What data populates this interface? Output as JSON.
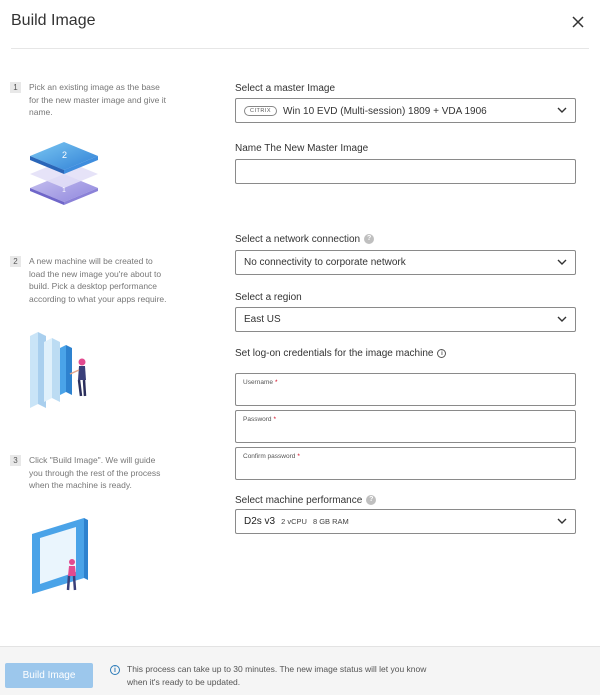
{
  "dialog": {
    "title": "Build Image",
    "close_icon": "close-icon"
  },
  "steps": [
    {
      "number": "1",
      "text": "Pick an existing image as the base for the new master image and give it name."
    },
    {
      "number": "2",
      "text": "A new machine will be created to load the new image you're about to build. Pick a desktop performance according to what your apps require."
    },
    {
      "number": "3",
      "text": "Click \"Build Image\". We will guide you through the rest of the process when the machine is ready."
    }
  ],
  "form": {
    "master_image": {
      "label": "Select a master Image",
      "badge": "CITRIX",
      "value": "Win 10 EVD (Multi-session) 1809 + VDA 1906"
    },
    "new_name": {
      "label": "Name The New Master Image",
      "value": ""
    },
    "network": {
      "label": "Select a network connection",
      "value": "No connectivity to corporate network"
    },
    "region": {
      "label": "Select a region",
      "value": "East US"
    },
    "credentials": {
      "label": "Set log-on credentials for the image machine",
      "username_label": "Username",
      "password_label": "Password",
      "confirm_label": "Confirm password",
      "required_mark": "*"
    },
    "performance": {
      "label": "Select machine performance",
      "name": "D2s v3",
      "cpu": "2 vCPU",
      "ram": "8 GB RAM"
    }
  },
  "footer": {
    "button_label": "Build Image",
    "message": "This process can take up to 30 minutes. The new image status will let you know when it's ready to be updated."
  },
  "colors": {
    "accent_button": "#9cc7ec",
    "info_blue": "#2a7ab8",
    "required_red": "#d0021b"
  }
}
